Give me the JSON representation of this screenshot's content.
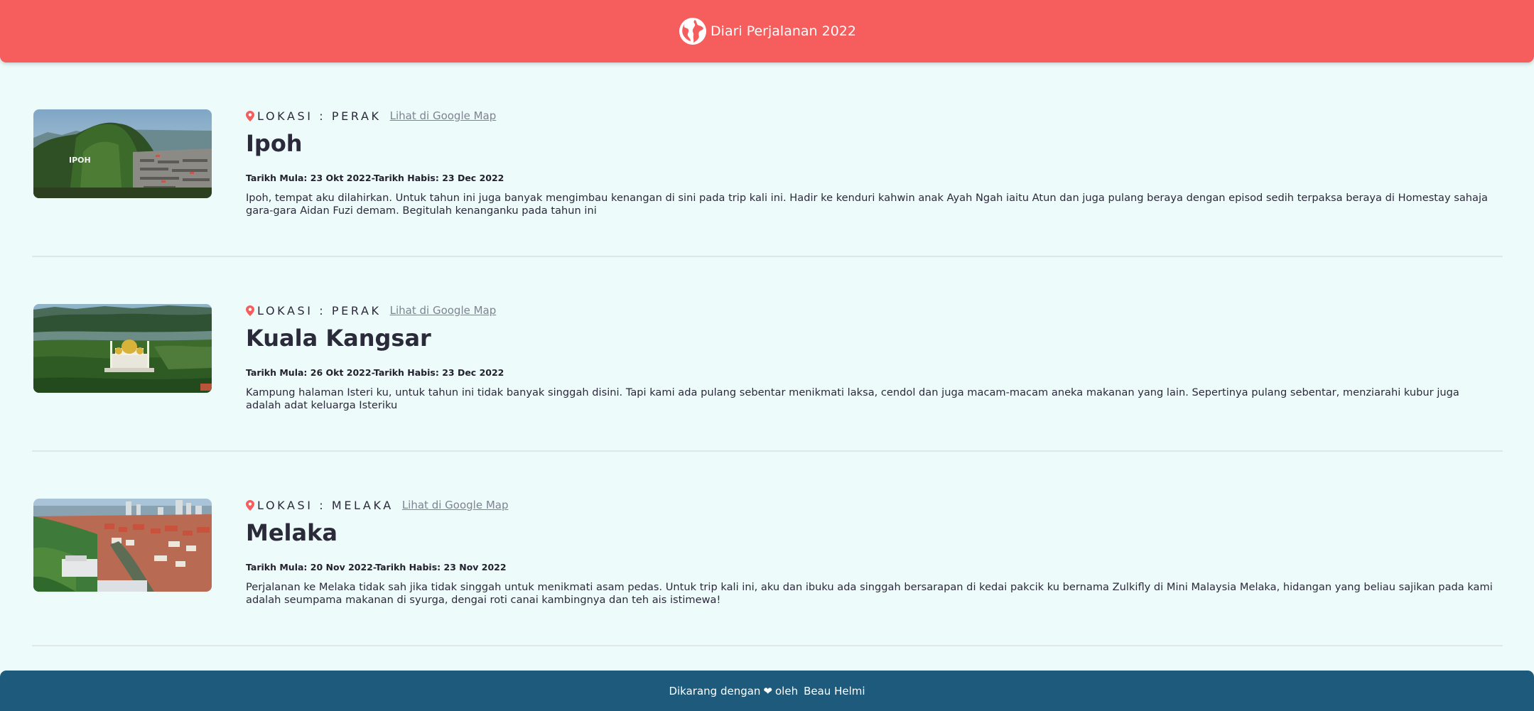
{
  "header": {
    "title": "Diari Perjalanan 2022",
    "icon": "globe-icon",
    "bg_color": "#f65d5d"
  },
  "entries": [
    {
      "location": "LOKASI : PERAK",
      "map_link": "Lihat di Google Map",
      "place": "Ipoh",
      "dates": "Tarikh Mula: 23 Okt 2022-Tarikh Habis: 23 Dec 2022",
      "description": "Ipoh, tempat aku dilahirkan. Untuk tahun ini juga banyak mengimbau kenangan di sini pada trip kali ini. Hadir ke kenduri kahwin anak Ayah Ngah iaitu Atun dan juga pulang beraya dengan episod sedih terpaksa beraya di Homestay sahaja gara-gara Aidan Fuzi demam. Begitulah kenanganku pada tahun ini",
      "image_text": "IPOH"
    },
    {
      "location": "LOKASI : PERAK",
      "map_link": "Lihat di Google Map",
      "place": "Kuala Kangsar",
      "dates": "Tarikh Mula: 26 Okt 2022-Tarikh Habis: 23 Dec 2022",
      "description": "Kampung halaman Isteri ku, untuk tahun ini tidak banyak singgah disini. Tapi kami ada pulang sebentar menikmati laksa, cendol dan juga macam-macam aneka makanan yang lain. Sepertinya pulang sebentar, menziarahi kubur juga adalah adat keluarga Isteriku"
    },
    {
      "location": "LOKASI : MELAKA",
      "map_link": "Lihat di Google Map",
      "place": "Melaka",
      "dates": "Tarikh Mula: 20 Nov 2022-Tarikh Habis: 23 Nov 2022",
      "description": "Perjalanan ke Melaka tidak sah jika tidak singgah untuk menikmati asam pedas. Untuk trip kali ini, aku dan ibuku ada singgah bersarapan di kedai pakcik ku bernama Zulkifly di Mini Malaysia Melaka, hidangan yang beliau sajikan pada kami adalah seumpama makanan di syurga, dengai roti canai kambingnya dan teh ais istimewa!"
    }
  ],
  "footer": {
    "made_with": "Dikarang dengan",
    "heart": "❤",
    "by": "oleh",
    "author": "Beau Helmi",
    "bg_color": "#1d5a7c"
  },
  "colors": {
    "accent": "#f65d5d",
    "pin": "#f65d5d",
    "link": "#7d8390"
  }
}
